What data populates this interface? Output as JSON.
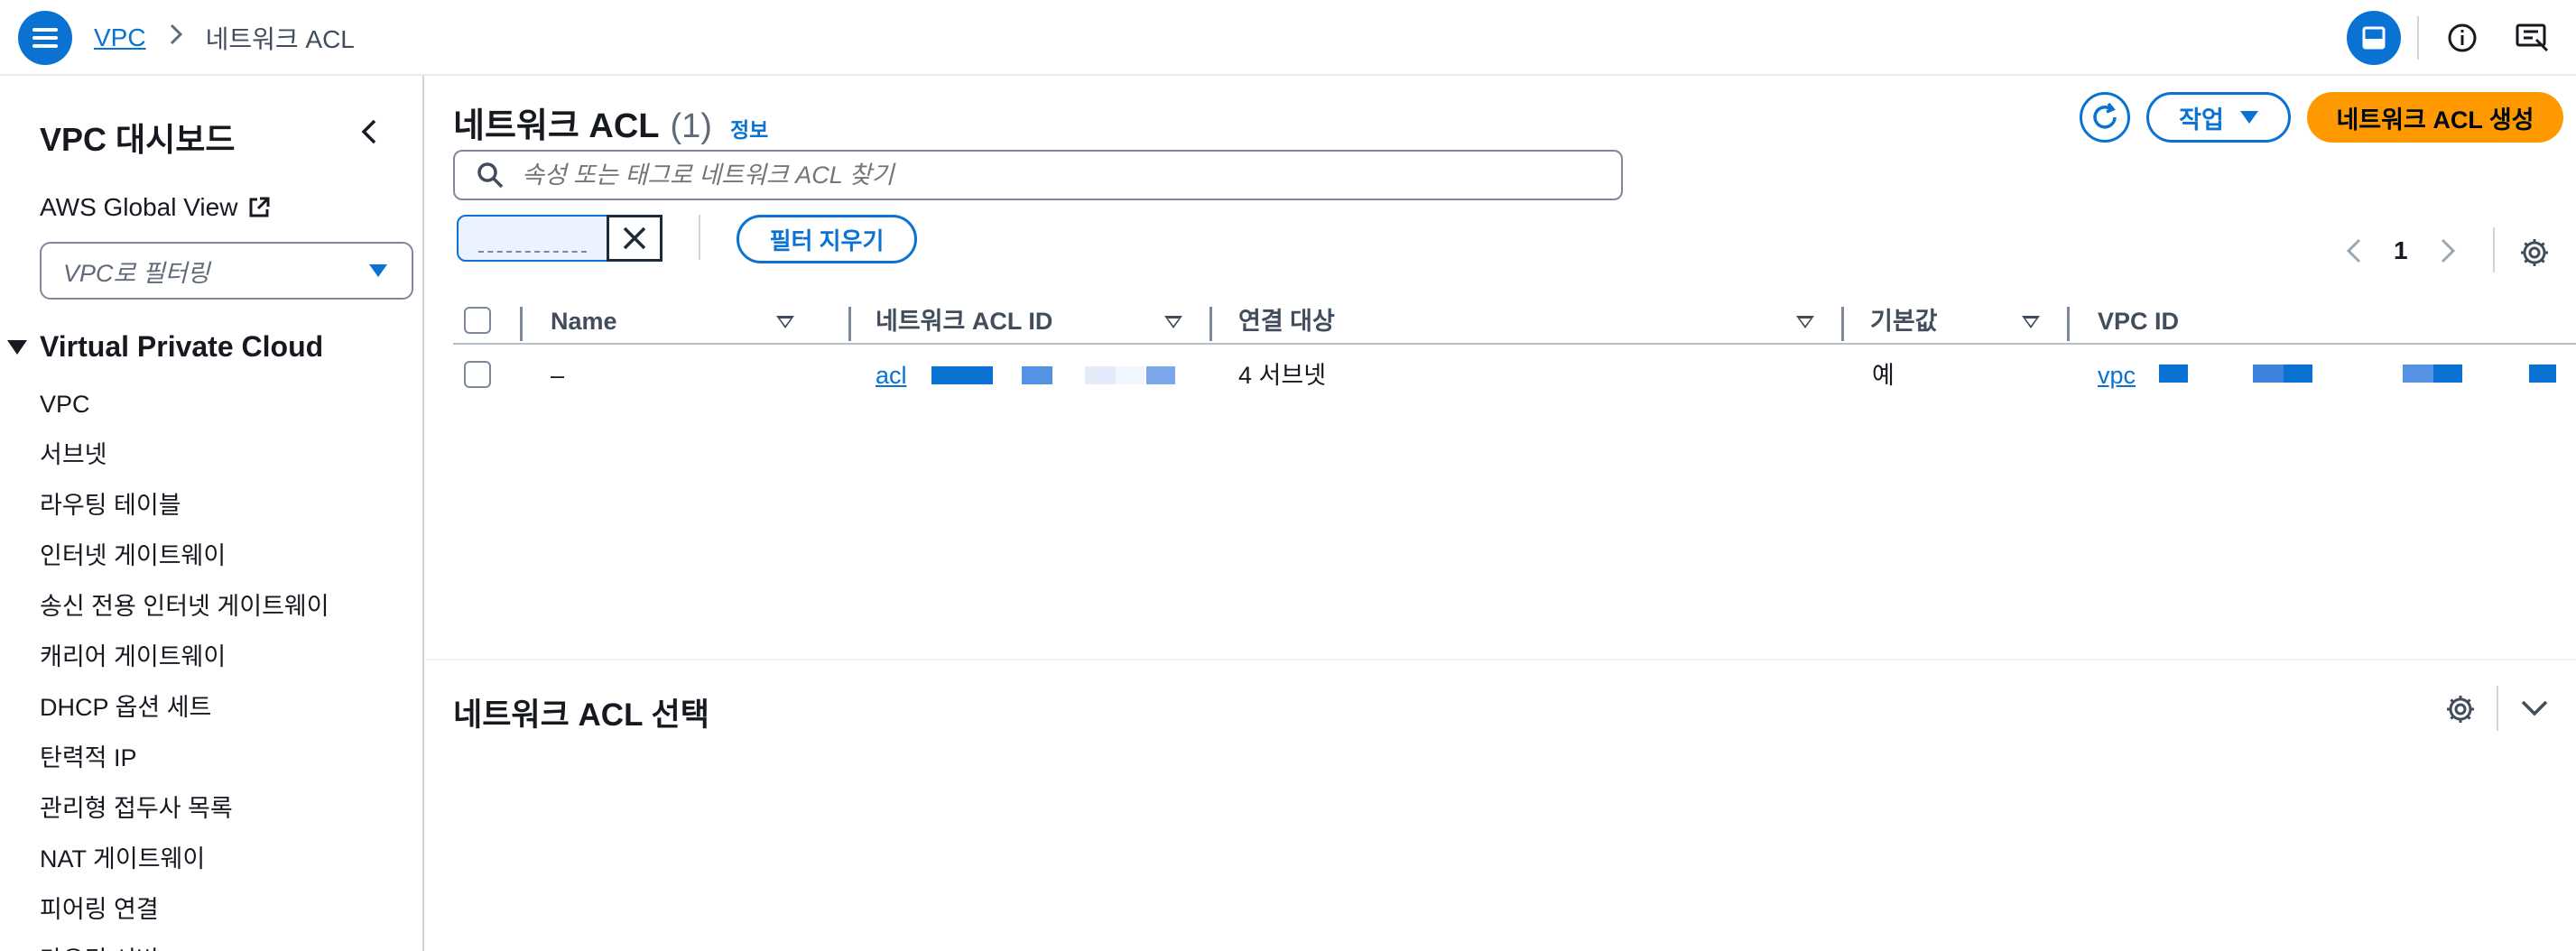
{
  "breadcrumb": {
    "root": "VPC",
    "current": "네트워크 ACL"
  },
  "sidebar": {
    "title": "VPC 대시보드",
    "global_view": "AWS Global View",
    "vpc_filter_placeholder": "VPC로 필터링",
    "section": "Virtual Private Cloud",
    "items": [
      "VPC",
      "서브넷",
      "라우팅 테이블",
      "인터넷 게이트웨이",
      "송신 전용 인터넷 게이트웨이",
      "캐리어 게이트웨이",
      "DHCP 옵션 세트",
      "탄력적 IP",
      "관리형 접두사 목록",
      "NAT 게이트웨이",
      "피어링 연결",
      "라우팅 서버"
    ]
  },
  "main": {
    "title": "네트워크 ACL",
    "count": "(1)",
    "info_link": "정보",
    "actions_label": "작업",
    "create_label": "네트워크 ACL 생성",
    "search_placeholder": "속성 또는 태그로 네트워크 ACL 찾기",
    "clear_filters_label": "필터 지우기",
    "page_number": "1",
    "columns": [
      "Name",
      "네트워크 ACL ID",
      "연결 대상",
      "기본값",
      "VPC ID"
    ],
    "rows": [
      {
        "name": "–",
        "acl_id_prefix": "acl",
        "associated": "4 서브넷",
        "default": "예",
        "vpc_prefix": "vpc"
      }
    ]
  },
  "split_panel": {
    "title": "네트워크 ACL 선택"
  },
  "colors": {
    "accent": "#0972d3",
    "primary_button": "#ff9900",
    "redaction": "#0972d3"
  },
  "icons": [
    "menu-icon",
    "chevron-right-icon",
    "panel-icon",
    "info-icon",
    "feedback-icon",
    "chevron-left-icon",
    "external-link-icon",
    "caret-down-icon",
    "refresh-icon",
    "search-icon",
    "close-icon",
    "settings-icon",
    "chevron-down-icon"
  ]
}
